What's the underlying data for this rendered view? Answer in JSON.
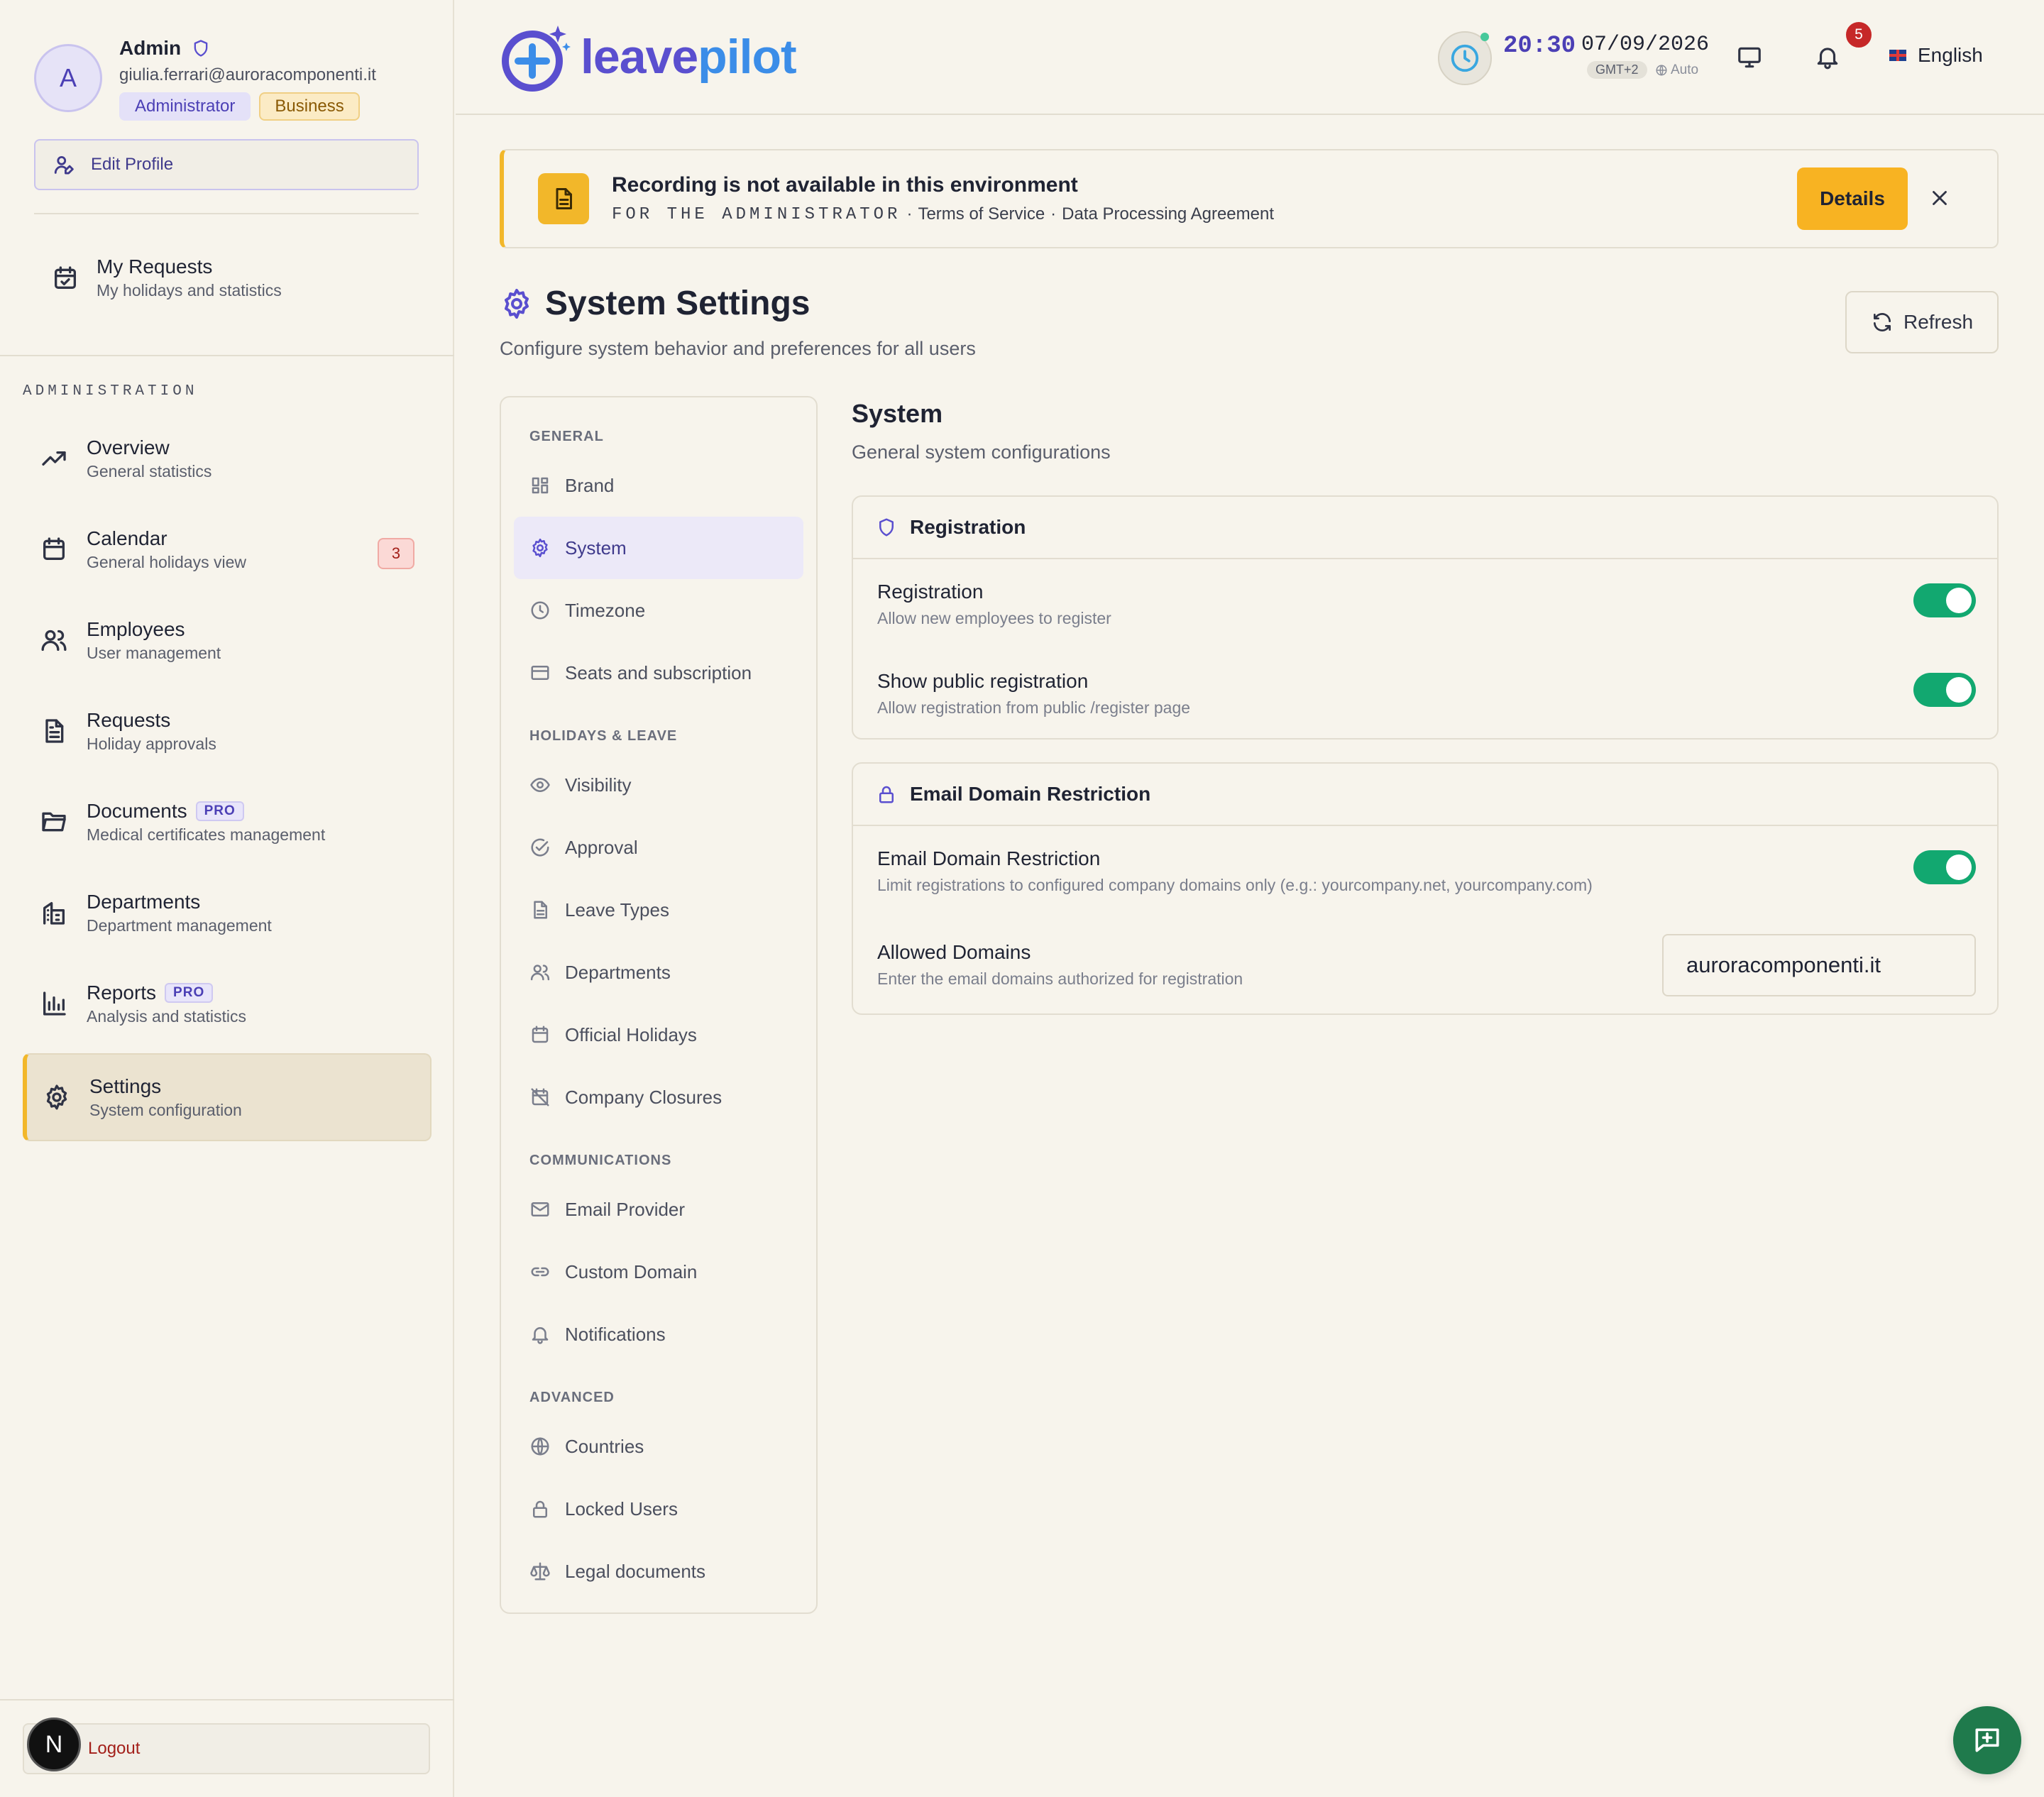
{
  "user": {
    "avatar_initial": "A",
    "name": "Admin",
    "email": "giulia.ferrari@auroracomponenti.it",
    "role_badge": "Administrator",
    "plan_badge": "Business",
    "edit_profile_label": "Edit Profile"
  },
  "my_requests": {
    "title": "My Requests",
    "subtitle": "My holidays and statistics"
  },
  "admin_section_label": "ADMINISTRATION",
  "nav": [
    {
      "title": "Overview",
      "subtitle": "General statistics",
      "icon": "trending-up-icon"
    },
    {
      "title": "Calendar",
      "subtitle": "General holidays view",
      "icon": "calendar-icon",
      "badge": "3"
    },
    {
      "title": "Employees",
      "subtitle": "User management",
      "icon": "users-icon"
    },
    {
      "title": "Requests",
      "subtitle": "Holiday approvals",
      "icon": "file-text-icon"
    },
    {
      "title": "Documents",
      "subtitle": "Medical certificates management",
      "icon": "folder-icon",
      "pro": "PRO"
    },
    {
      "title": "Departments",
      "subtitle": "Department management",
      "icon": "building-icon"
    },
    {
      "title": "Reports",
      "subtitle": "Analysis and statistics",
      "icon": "bar-chart-icon",
      "pro": "PRO"
    },
    {
      "title": "Settings",
      "subtitle": "System configuration",
      "icon": "gear-icon",
      "active": true
    }
  ],
  "logout_label": "Logout",
  "n_badge": "N",
  "header": {
    "logo_leave": "leave",
    "logo_pilot": "pilot",
    "time": "20:30",
    "date": "07/09/2026",
    "timezone": "GMT+2",
    "tz_mode": "Auto",
    "notifications_count": "5",
    "language": "English"
  },
  "banner": {
    "title": "Recording is not available in this environment",
    "audience": "FOR THE ADMINISTRATOR",
    "sep": "·",
    "link1": "Terms of Service",
    "link2": "Data Processing Agreement",
    "details_label": "Details"
  },
  "page": {
    "title": "System Settings",
    "subtitle": "Configure system behavior and preferences for all users",
    "refresh_label": "Refresh"
  },
  "settings_nav": {
    "groups": {
      "general": "GENERAL",
      "holidays": "HOLIDAYS & LEAVE",
      "communications": "COMMUNICATIONS",
      "advanced": "ADVANCED"
    },
    "items": {
      "brand": "Brand",
      "system": "System",
      "timezone": "Timezone",
      "seats": "Seats and subscription",
      "visibility": "Visibility",
      "approval": "Approval",
      "leave_types": "Leave Types",
      "departments": "Departments",
      "official_holidays": "Official Holidays",
      "company_closures": "Company Closures",
      "email_provider": "Email Provider",
      "custom_domain": "Custom Domain",
      "notifications": "Notifications",
      "countries": "Countries",
      "locked_users": "Locked Users",
      "legal_documents": "Legal documents"
    }
  },
  "section": {
    "title": "System",
    "subtitle": "General system configurations",
    "registration_card": {
      "title": "Registration",
      "rows": [
        {
          "title": "Registration",
          "subtitle": "Allow new employees to register",
          "enabled": true
        },
        {
          "title": "Show public registration",
          "subtitle": "Allow registration from public /register page",
          "enabled": true
        }
      ]
    },
    "email_card": {
      "title": "Email Domain Restriction",
      "toggle_row": {
        "title": "Email Domain Restriction",
        "subtitle": "Limit registrations to configured company domains only (e.g.: yourcompany.net, yourcompany.com)",
        "enabled": true
      },
      "domains_row": {
        "title": "Allowed Domains",
        "subtitle": "Enter the email domains authorized for registration",
        "value": "auroracomponenti.it"
      }
    }
  },
  "colors": {
    "accent": "#5a4fcf",
    "warning": "#f2b72a",
    "toggle_on": "#12a870",
    "danger": "#c62828"
  }
}
